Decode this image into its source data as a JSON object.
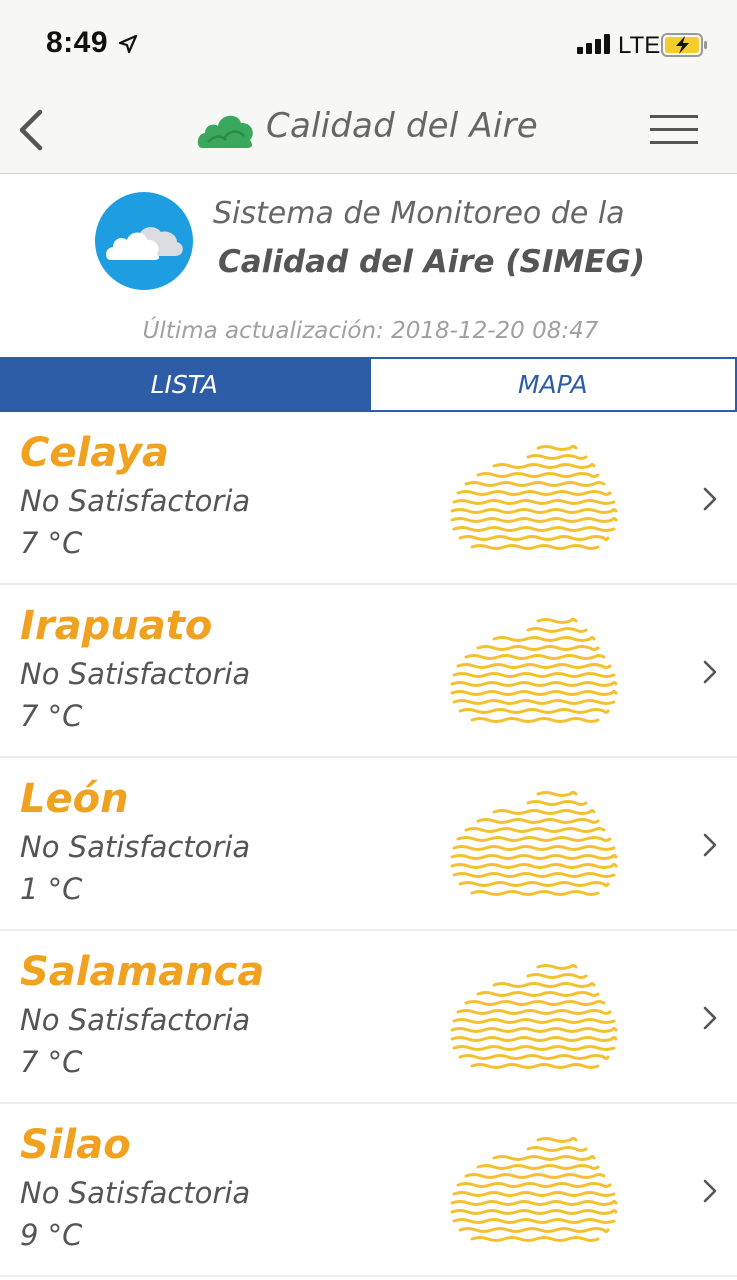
{
  "status_bar": {
    "time": "8:49",
    "network": "LTE"
  },
  "nav": {
    "title": "Calidad del Aire"
  },
  "header": {
    "line1": "Sistema de Monitoreo de la",
    "line2": "Calidad del Aire (SIMEG)",
    "last_update": "Última actualización: 2018-12-20 08:47"
  },
  "tabs": [
    {
      "label": "LISTA",
      "active": true
    },
    {
      "label": "MAPA",
      "active": false
    }
  ],
  "cities": [
    {
      "name": "Celaya",
      "status": "No Satisfactoria",
      "temp": "7 °C"
    },
    {
      "name": "Irapuato",
      "status": "No Satisfactoria",
      "temp": "7 °C"
    },
    {
      "name": "León",
      "status": "No Satisfactoria",
      "temp": "1 °C"
    },
    {
      "name": "Salamanca",
      "status": "No Satisfactoria",
      "temp": "7 °C"
    },
    {
      "name": "Silao",
      "status": "No Satisfactoria",
      "temp": "9 °C"
    }
  ],
  "colors": {
    "accent_blue": "#2e5da8",
    "city_orange": "#efa11f",
    "haze_yellow": "#f4c030",
    "logo_blue": "#1e9ee0",
    "logo_green": "#3aa85c"
  },
  "icons": {
    "back": "chevron-left-icon",
    "menu": "hamburger-menu-icon",
    "row": "chevron-right-icon",
    "quality": "hazy-cloud-icon"
  }
}
